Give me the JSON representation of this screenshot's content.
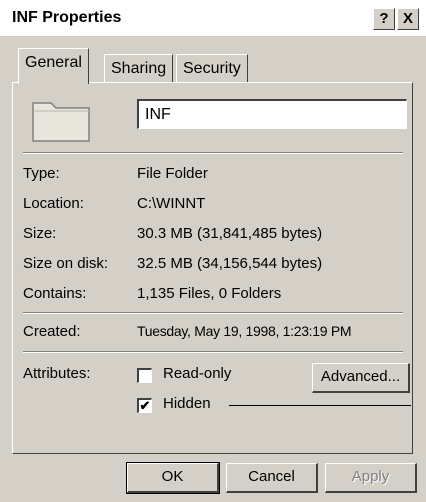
{
  "window": {
    "title": "INF Properties",
    "help_label": "?",
    "close_label": "X"
  },
  "tabs": [
    {
      "label": "General",
      "active": true
    },
    {
      "label": "Sharing",
      "active": false
    },
    {
      "label": "Security",
      "active": false
    }
  ],
  "general": {
    "icon": "folder-icon",
    "name_value": "INF",
    "rows": [
      {
        "label": "Type:",
        "value": "File Folder"
      },
      {
        "label": "Location:",
        "value": "C:\\WINNT"
      },
      {
        "label": "Size:",
        "value": "30.3 MB (31,841,485 bytes)"
      },
      {
        "label": "Size on disk:",
        "value": "32.5 MB (34,156,544 bytes)"
      },
      {
        "label": "Contains:",
        "value": "1,135 Files, 0 Folders"
      }
    ],
    "created_label": "Created:",
    "created_value": "Tuesday, May 19, 1998, 1:23:19 PM",
    "attributes_label": "Attributes:",
    "readonly_label": "Read-only",
    "readonly_checked": false,
    "hidden_label": "Hidden",
    "hidden_checked": true,
    "checkmark": "✔",
    "advanced_label": "Advanced..."
  },
  "buttons": {
    "ok_label": "OK",
    "cancel_label": "Cancel",
    "apply_label": "Apply"
  },
  "colors": {
    "face": "#d4d0c8",
    "titlebar": "#ffffff",
    "disabled_text": "#808080"
  }
}
